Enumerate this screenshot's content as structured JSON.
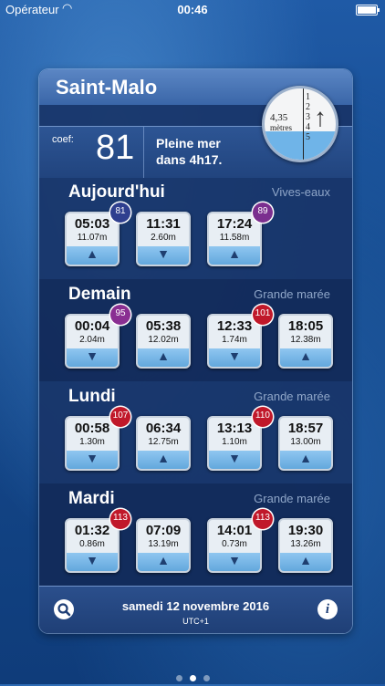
{
  "status_bar": {
    "carrier": "Opérateur",
    "time": "00:46"
  },
  "header": {
    "city": "Saint-Malo"
  },
  "summary": {
    "coef_label": "coef:",
    "coef_value": "81",
    "pleine_mer_line1": "Pleine mer",
    "pleine_mer_line2": "dans 4h17."
  },
  "gauge": {
    "value": "4,35",
    "unit": "mètres",
    "scale_numbers": [
      "1",
      "2",
      "3",
      "4",
      "5"
    ],
    "direction": "rising",
    "icon": "up-arrow-icon",
    "level_fraction": 0.4
  },
  "days": [
    {
      "name": "Aujourd'hui",
      "type": "Vives-eaux",
      "tides": [
        {
          "time": "05:03",
          "height": "11.07m",
          "direction": "up",
          "coef": "81",
          "coef_color": "#2f3f8f"
        },
        {
          "time": "11:31",
          "height": "2.60m",
          "direction": "down"
        },
        {
          "time": "17:24",
          "height": "11.58m",
          "direction": "up",
          "coef": "89",
          "coef_color": "#7b2f8f"
        }
      ]
    },
    {
      "name": "Demain",
      "type": "Grande marée",
      "tides": [
        {
          "time": "00:04",
          "height": "2.04m",
          "direction": "down",
          "coef": "95",
          "coef_color": "#8a2f92"
        },
        {
          "time": "05:38",
          "height": "12.02m",
          "direction": "up"
        },
        {
          "time": "12:33",
          "height": "1.74m",
          "direction": "down",
          "coef": "101",
          "coef_color": "#c0182a"
        },
        {
          "time": "18:05",
          "height": "12.38m",
          "direction": "up"
        }
      ]
    },
    {
      "name": "Lundi",
      "type": "Grande marée",
      "tides": [
        {
          "time": "00:58",
          "height": "1.30m",
          "direction": "down",
          "coef": "107",
          "coef_color": "#c0182a"
        },
        {
          "time": "06:34",
          "height": "12.75m",
          "direction": "up"
        },
        {
          "time": "13:13",
          "height": "1.10m",
          "direction": "down",
          "coef": "110",
          "coef_color": "#c0182a"
        },
        {
          "time": "18:57",
          "height": "13.00m",
          "direction": "up"
        }
      ]
    },
    {
      "name": "Mardi",
      "type": "Grande marée",
      "tides": [
        {
          "time": "01:32",
          "height": "0.86m",
          "direction": "down",
          "coef": "113",
          "coef_color": "#c0182a"
        },
        {
          "time": "07:09",
          "height": "13.19m",
          "direction": "up"
        },
        {
          "time": "14:01",
          "height": "0.73m",
          "direction": "down",
          "coef": "113",
          "coef_color": "#c0182a"
        },
        {
          "time": "19:30",
          "height": "13.26m",
          "direction": "up"
        }
      ]
    }
  ],
  "footer": {
    "date": "samedi 12 novembre 2016",
    "timezone": "UTC+1"
  },
  "page_indicator": {
    "count": 3,
    "active": 2
  },
  "colors": {
    "accent": "#3a66a8",
    "water": "#6fb4e8"
  }
}
